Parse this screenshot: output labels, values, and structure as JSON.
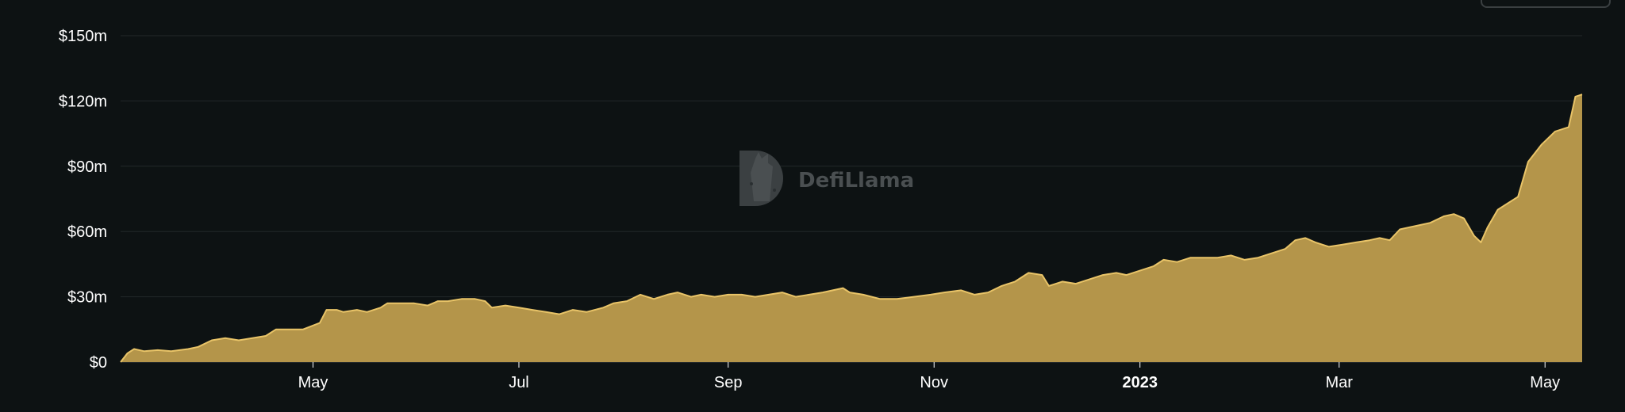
{
  "colors": {
    "background": "#0d1213",
    "area_fill": "#b4954a",
    "area_line": "#e9c468",
    "gridline": "#22282a",
    "axis_text": "#ffffff",
    "watermark": "#4a4f51"
  },
  "watermark": {
    "text": "DefiLlama",
    "icon": "llama-logo-icon"
  },
  "chart_data": {
    "type": "area",
    "title": "",
    "xlabel": "",
    "ylabel": "",
    "ylim": [
      0,
      150
    ],
    "y_unit": "USD millions",
    "grid": true,
    "legend": "none",
    "y_ticks": [
      {
        "value": 0,
        "label": "$0"
      },
      {
        "value": 30,
        "label": "$30m"
      },
      {
        "value": 60,
        "label": "$60m"
      },
      {
        "value": 90,
        "label": "$90m"
      },
      {
        "value": 120,
        "label": "$120m"
      },
      {
        "value": 150,
        "label": "$150m"
      }
    ],
    "x_range": [
      "2022-03-05",
      "2023-05-12"
    ],
    "x_ticks": [
      {
        "date": "2022-05-01",
        "label": "May",
        "bold": false
      },
      {
        "date": "2022-07-01",
        "label": "Jul",
        "bold": false
      },
      {
        "date": "2022-09-01",
        "label": "Sep",
        "bold": false
      },
      {
        "date": "2022-11-01",
        "label": "Nov",
        "bold": false
      },
      {
        "date": "2023-01-01",
        "label": "2023",
        "bold": true
      },
      {
        "date": "2023-03-01",
        "label": "Mar",
        "bold": false
      },
      {
        "date": "2023-05-01",
        "label": "May",
        "bold": false
      }
    ],
    "series": [
      {
        "points": [
          [
            "2022-03-05",
            0
          ],
          [
            "2022-03-07",
            4
          ],
          [
            "2022-03-09",
            6
          ],
          [
            "2022-03-12",
            5
          ],
          [
            "2022-03-16",
            5.5
          ],
          [
            "2022-03-20",
            5
          ],
          [
            "2022-03-25",
            6
          ],
          [
            "2022-03-28",
            7
          ],
          [
            "2022-04-01",
            10
          ],
          [
            "2022-04-05",
            11
          ],
          [
            "2022-04-09",
            10
          ],
          [
            "2022-04-13",
            11
          ],
          [
            "2022-04-17",
            12
          ],
          [
            "2022-04-20",
            15
          ],
          [
            "2022-04-25",
            15
          ],
          [
            "2022-04-28",
            15
          ],
          [
            "2022-05-03",
            18
          ],
          [
            "2022-05-05",
            24
          ],
          [
            "2022-05-08",
            24
          ],
          [
            "2022-05-10",
            23
          ],
          [
            "2022-05-14",
            24
          ],
          [
            "2022-05-17",
            23
          ],
          [
            "2022-05-21",
            25
          ],
          [
            "2022-05-23",
            27
          ],
          [
            "2022-05-27",
            27
          ],
          [
            "2022-05-31",
            27
          ],
          [
            "2022-06-04",
            26
          ],
          [
            "2022-06-07",
            28
          ],
          [
            "2022-06-10",
            28
          ],
          [
            "2022-06-14",
            29
          ],
          [
            "2022-06-18",
            29
          ],
          [
            "2022-06-21",
            28
          ],
          [
            "2022-06-23",
            25
          ],
          [
            "2022-06-27",
            26
          ],
          [
            "2022-07-01",
            25
          ],
          [
            "2022-07-05",
            24
          ],
          [
            "2022-07-09",
            23
          ],
          [
            "2022-07-13",
            22
          ],
          [
            "2022-07-17",
            24
          ],
          [
            "2022-07-21",
            23
          ],
          [
            "2022-07-26",
            25
          ],
          [
            "2022-07-29",
            27
          ],
          [
            "2022-08-02",
            28
          ],
          [
            "2022-08-06",
            31
          ],
          [
            "2022-08-10",
            29
          ],
          [
            "2022-08-14",
            31
          ],
          [
            "2022-08-17",
            32
          ],
          [
            "2022-08-21",
            30
          ],
          [
            "2022-08-24",
            31
          ],
          [
            "2022-08-28",
            30
          ],
          [
            "2022-09-01",
            31
          ],
          [
            "2022-09-05",
            31
          ],
          [
            "2022-09-09",
            30
          ],
          [
            "2022-09-13",
            31
          ],
          [
            "2022-09-17",
            32
          ],
          [
            "2022-09-21",
            30
          ],
          [
            "2022-09-25",
            31
          ],
          [
            "2022-09-29",
            32
          ],
          [
            "2022-10-02",
            33
          ],
          [
            "2022-10-05",
            34
          ],
          [
            "2022-10-07",
            32
          ],
          [
            "2022-10-11",
            31
          ],
          [
            "2022-10-16",
            29
          ],
          [
            "2022-10-21",
            29
          ],
          [
            "2022-10-26",
            30
          ],
          [
            "2022-10-31",
            31
          ],
          [
            "2022-11-04",
            32
          ],
          [
            "2022-11-09",
            33
          ],
          [
            "2022-11-13",
            31
          ],
          [
            "2022-11-17",
            32
          ],
          [
            "2022-11-21",
            35
          ],
          [
            "2022-11-25",
            37
          ],
          [
            "2022-11-29",
            41
          ],
          [
            "2022-12-03",
            40
          ],
          [
            "2022-12-05",
            35
          ],
          [
            "2022-12-09",
            37
          ],
          [
            "2022-12-13",
            36
          ],
          [
            "2022-12-17",
            38
          ],
          [
            "2022-12-21",
            40
          ],
          [
            "2022-12-25",
            41
          ],
          [
            "2022-12-28",
            40
          ],
          [
            "2023-01-01",
            42
          ],
          [
            "2023-01-05",
            44
          ],
          [
            "2023-01-08",
            47
          ],
          [
            "2023-01-12",
            46
          ],
          [
            "2023-01-16",
            48
          ],
          [
            "2023-01-20",
            48
          ],
          [
            "2023-01-24",
            48
          ],
          [
            "2023-01-28",
            49
          ],
          [
            "2023-02-01",
            47
          ],
          [
            "2023-02-05",
            48
          ],
          [
            "2023-02-09",
            50
          ],
          [
            "2023-02-13",
            52
          ],
          [
            "2023-02-16",
            56
          ],
          [
            "2023-02-19",
            57
          ],
          [
            "2023-02-22",
            55
          ],
          [
            "2023-02-26",
            53
          ],
          [
            "2023-03-02",
            54
          ],
          [
            "2023-03-06",
            55
          ],
          [
            "2023-03-10",
            56
          ],
          [
            "2023-03-13",
            57
          ],
          [
            "2023-03-16",
            56
          ],
          [
            "2023-03-19",
            61
          ],
          [
            "2023-03-22",
            62
          ],
          [
            "2023-03-25",
            63
          ],
          [
            "2023-03-28",
            64
          ],
          [
            "2023-04-01",
            67
          ],
          [
            "2023-04-04",
            68
          ],
          [
            "2023-04-07",
            66
          ],
          [
            "2023-04-10",
            58
          ],
          [
            "2023-04-12",
            55
          ],
          [
            "2023-04-14",
            62
          ],
          [
            "2023-04-17",
            70
          ],
          [
            "2023-04-20",
            73
          ],
          [
            "2023-04-23",
            76
          ],
          [
            "2023-04-26",
            92
          ],
          [
            "2023-04-30",
            100
          ],
          [
            "2023-05-04",
            106
          ],
          [
            "2023-05-08",
            108
          ],
          [
            "2023-05-10",
            122
          ],
          [
            "2023-05-12",
            123
          ]
        ]
      }
    ]
  }
}
